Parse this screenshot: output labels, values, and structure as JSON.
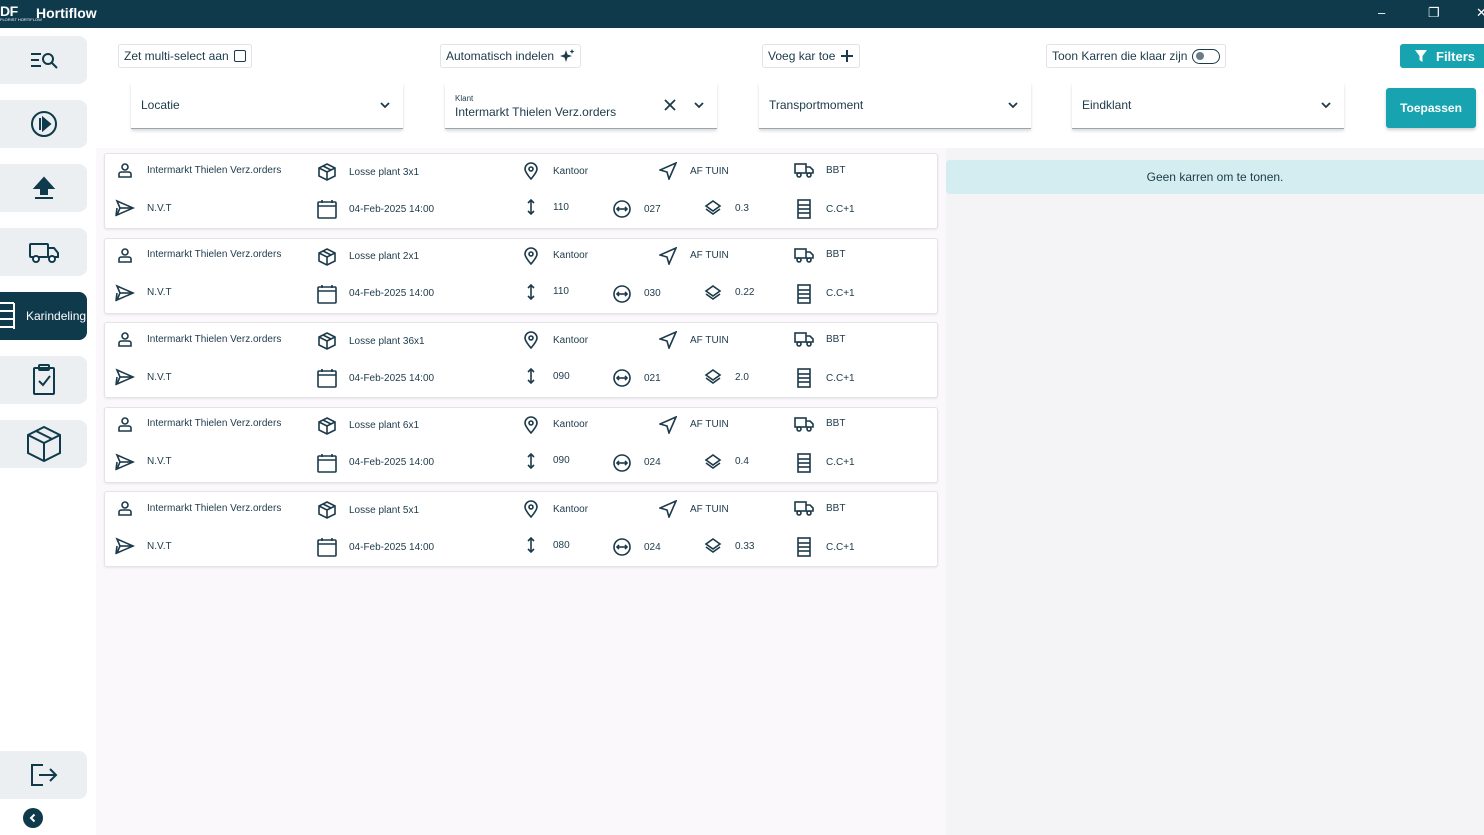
{
  "app": {
    "logo": "DF",
    "logo_sub": "FLORIST HORTIFLOW",
    "title": "Hortiflow",
    "minimize": "–",
    "restore": "❐",
    "close": "✕"
  },
  "sidebar": {
    "items": [
      {
        "icon": "search-list-icon",
        "label": ""
      },
      {
        "icon": "play-circle-icon",
        "label": ""
      },
      {
        "icon": "upload-icon",
        "label": ""
      },
      {
        "icon": "truck-icon",
        "label": ""
      },
      {
        "icon": "list-icon",
        "label": "Karindeling",
        "active": true
      },
      {
        "icon": "clipboard-check-icon",
        "label": ""
      },
      {
        "icon": "box-icon",
        "label": ""
      },
      {
        "icon": "logout-icon",
        "label": ""
      }
    ]
  },
  "toolbar": {
    "multiselect_label": "Zet multi-select aan",
    "auto_label": "Automatisch indelen",
    "add_cart_label": "Voeg kar toe",
    "show_ready_label": "Toon Karren die klaar zijn",
    "filters_label": "Filters"
  },
  "filters": {
    "location": {
      "placeholder": "Locatie"
    },
    "customer": {
      "label": "Klant",
      "value": "Intermarkt Thielen Verz.orders"
    },
    "transport": {
      "placeholder": "Transportmoment"
    },
    "end_customer": {
      "placeholder": "Eindklant"
    },
    "apply_label": "Toepassen"
  },
  "carts": [
    {
      "customer": "Intermarkt Thielen Verz.orders",
      "product": "Losse plant 3x1",
      "location": "Kantoor",
      "destination": "AF TUIN",
      "carrier": "BBT",
      "ref": "N.V.T",
      "date": "04-Feb-2025 14:00",
      "height": "110",
      "width": "027",
      "layers": "0.3",
      "cart_type": "C.C+1"
    },
    {
      "customer": "Intermarkt Thielen Verz.orders",
      "product": "Losse plant 2x1",
      "location": "Kantoor",
      "destination": "AF TUIN",
      "carrier": "BBT",
      "ref": "N.V.T",
      "date": "04-Feb-2025 14:00",
      "height": "110",
      "width": "030",
      "layers": "0.22",
      "cart_type": "C.C+1"
    },
    {
      "customer": "Intermarkt Thielen Verz.orders",
      "product": "Losse plant 36x1",
      "location": "Kantoor",
      "destination": "AF TUIN",
      "carrier": "BBT",
      "ref": "N.V.T",
      "date": "04-Feb-2025 14:00",
      "height": "090",
      "width": "021",
      "layers": "2.0",
      "cart_type": "C.C+1"
    },
    {
      "customer": "Intermarkt Thielen Verz.orders",
      "product": "Losse plant 6x1",
      "location": "Kantoor",
      "destination": "AF TUIN",
      "carrier": "BBT",
      "ref": "N.V.T",
      "date": "04-Feb-2025 14:00",
      "height": "090",
      "width": "024",
      "layers": "0.4",
      "cart_type": "C.C+1"
    },
    {
      "customer": "Intermarkt Thielen Verz.orders",
      "product": "Losse plant 5x1",
      "location": "Kantoor",
      "destination": "AF TUIN",
      "carrier": "BBT",
      "ref": "N.V.T",
      "date": "04-Feb-2025 14:00",
      "height": "080",
      "width": "024",
      "layers": "0.33",
      "cart_type": "C.C+1"
    }
  ],
  "right_panel": {
    "empty_message": "Geen karren om te tonen."
  },
  "colors": {
    "primary_dark": "#0e3a4c",
    "accent": "#17a3b0",
    "info_bg": "#d4edf0"
  }
}
